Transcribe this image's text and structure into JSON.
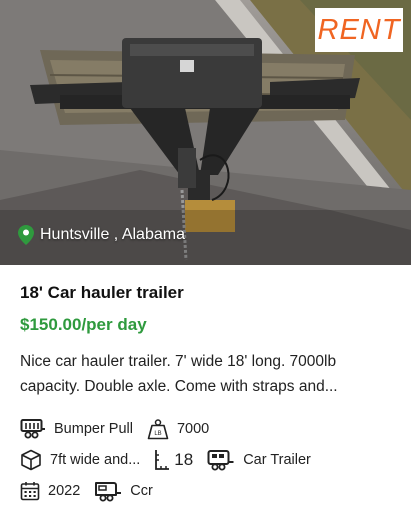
{
  "badge": {
    "label": "RENT",
    "color": "#f06522"
  },
  "location": {
    "text": "Huntsville , Alabama",
    "icon": "map-pin-icon",
    "icon_color": "#2f9a3e"
  },
  "listing": {
    "title": "18' Car hauler trailer",
    "price": "$150.00/per day",
    "price_color": "#2f9a3e",
    "description": "Nice car hauler trailer. 7' wide 18' long. 7000lb capacity. Double axle. Come with straps and..."
  },
  "specs": {
    "hitch": {
      "icon": "trailer-hitch-icon",
      "value": "Bumper Pull"
    },
    "capacity": {
      "icon": "weight-lb-icon",
      "value": "7000"
    },
    "dimensions": {
      "icon": "cube-icon",
      "value": "7ft wide and..."
    },
    "length": {
      "icon": "length-ruler-icon",
      "value": "18"
    },
    "type": {
      "icon": "car-trailer-icon",
      "value": "Car Trailer"
    },
    "year": {
      "icon": "calendar-icon",
      "value": "2022"
    },
    "brand": {
      "icon": "trailer-icon",
      "value": "Ccr"
    }
  }
}
